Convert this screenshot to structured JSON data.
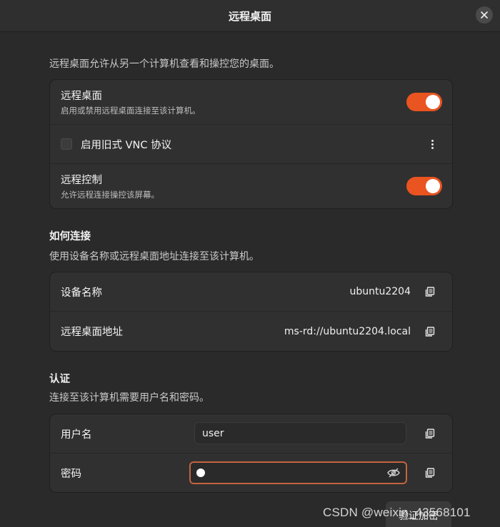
{
  "window": {
    "title": "远程桌面",
    "close_icon": "close-icon"
  },
  "intro": "远程桌面允许从另一个计算机查看和操控您的桌面。",
  "remote_desktop_card": {
    "remote_desktop": {
      "title": "远程桌面",
      "subtitle": "启用或禁用远程桌面连接至该计算机。",
      "enabled": true
    },
    "vnc": {
      "label": "启用旧式 VNC 协议",
      "checked": false
    },
    "remote_control": {
      "title": "远程控制",
      "subtitle": "允许远程连接操控该屏幕。",
      "enabled": true
    }
  },
  "how_to_connect": {
    "title": "如何连接",
    "description": "使用设备名称或远程桌面地址连接至该计算机。",
    "device_name_label": "设备名称",
    "device_name_value": "ubuntu2204",
    "address_label": "远程桌面地址",
    "address_value": "ms-rd://ubuntu2204.local"
  },
  "authentication": {
    "title": "认证",
    "description": "连接至该计算机需要用户名和密码。",
    "username_label": "用户名",
    "username_value": "user",
    "password_label": "密码"
  },
  "bottom_button_label": "验证加密",
  "watermark": "CSDN @weixin_43568101",
  "colors": {
    "accent": "#e95420",
    "background": "#2a2a2a",
    "card": "#303030"
  }
}
